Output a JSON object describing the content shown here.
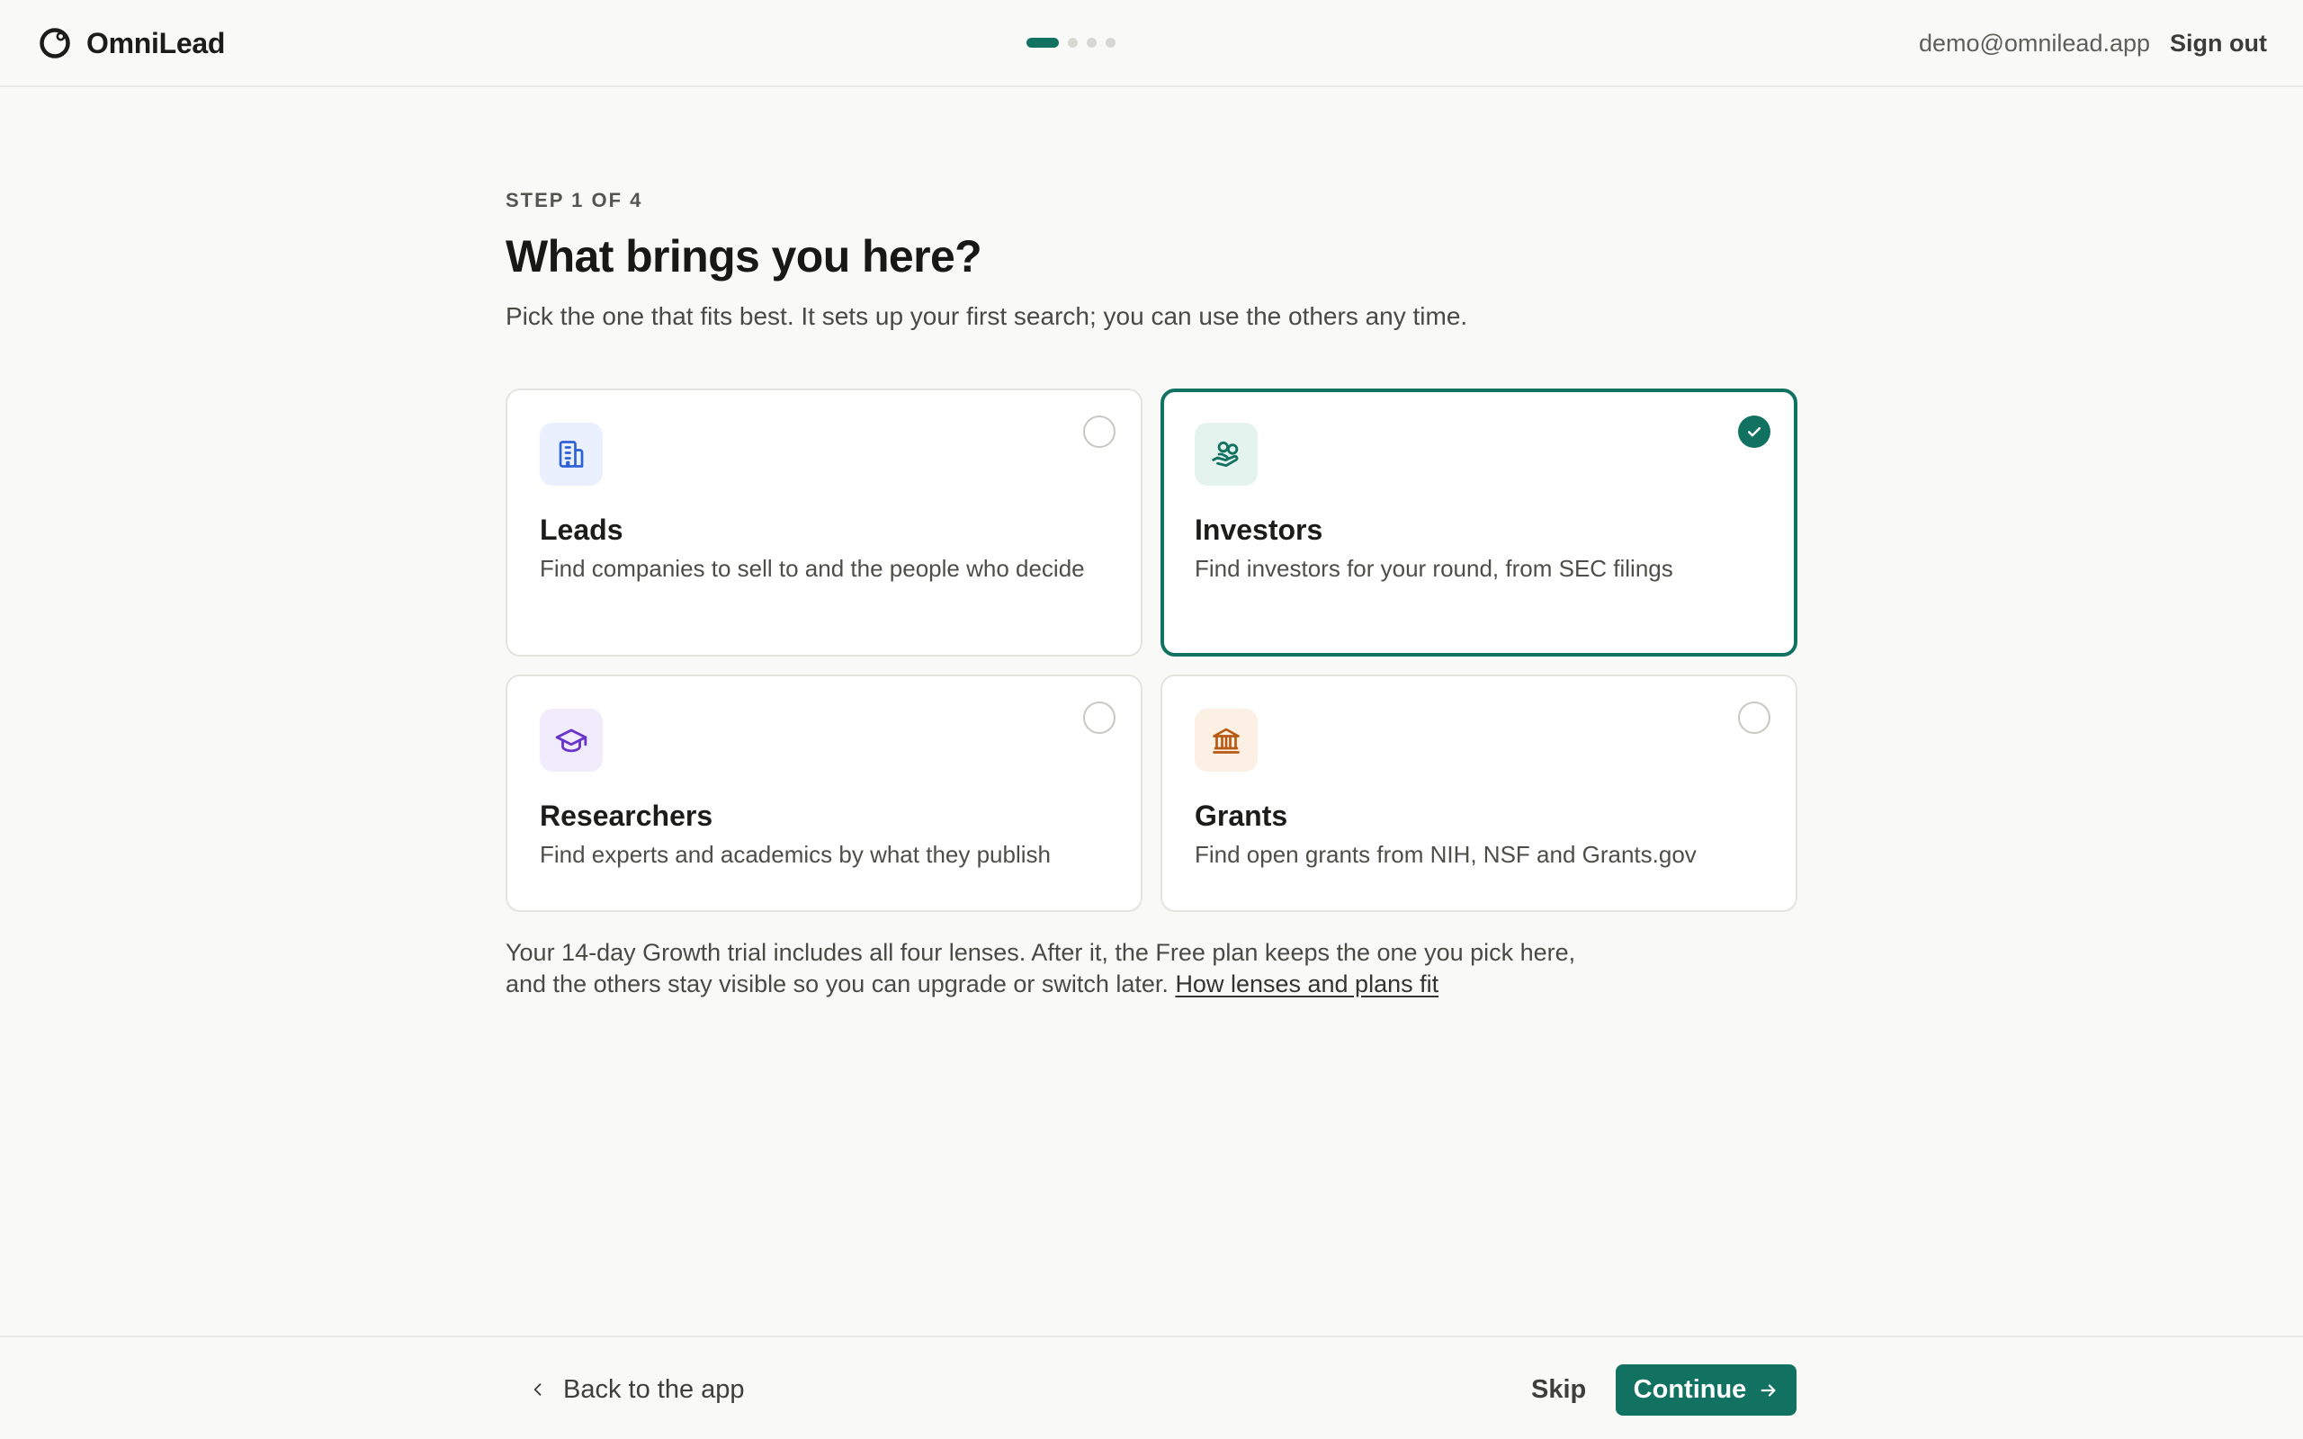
{
  "app": {
    "name": "OmniLead",
    "logo_icon": "omnilead-logo-icon"
  },
  "header": {
    "progress": {
      "total_steps": 4,
      "current_step": 1
    },
    "email": "demo@omnilead.app",
    "sign_out_label": "Sign out"
  },
  "main": {
    "step_label": "STEP 1 OF 4",
    "title": "What brings you here?",
    "subtitle": "Pick the one that fits best. It sets up your first search; you can use the others any time.",
    "options": [
      {
        "title": "Leads",
        "description": "Find companies to sell to and the people who decide",
        "icon": "building-icon",
        "selected": false,
        "icon_bg": "#eaf0fd",
        "icon_color": "#2f62d6"
      },
      {
        "title": "Investors",
        "description": "Find investors for your round, from SEC filings",
        "icon": "hand-coins-icon",
        "selected": true,
        "icon_bg": "#e5f3ef",
        "icon_color": "#127262"
      },
      {
        "title": "Researchers",
        "description": "Find experts and academics by what they publish",
        "icon": "graduation-cap-icon",
        "selected": false,
        "icon_bg": "#f1ecfc",
        "icon_color": "#6a35c9"
      },
      {
        "title": "Grants",
        "description": "Find open grants from NIH, NSF and Grants.gov",
        "icon": "landmark-icon",
        "selected": false,
        "icon_bg": "#fcefe4",
        "icon_color": "#b85a14"
      }
    ],
    "note_text": "Your 14-day Growth trial includes all four lenses. After it, the Free plan keeps the one you pick here, and the others stay visible so you can upgrade or switch later.",
    "note_link": "How lenses and plans fit"
  },
  "footer": {
    "back_label": "Back to the app",
    "skip_label": "Skip",
    "continue_label": "Continue"
  },
  "colors": {
    "accent": "#127262",
    "background": "#f9f9f7"
  }
}
